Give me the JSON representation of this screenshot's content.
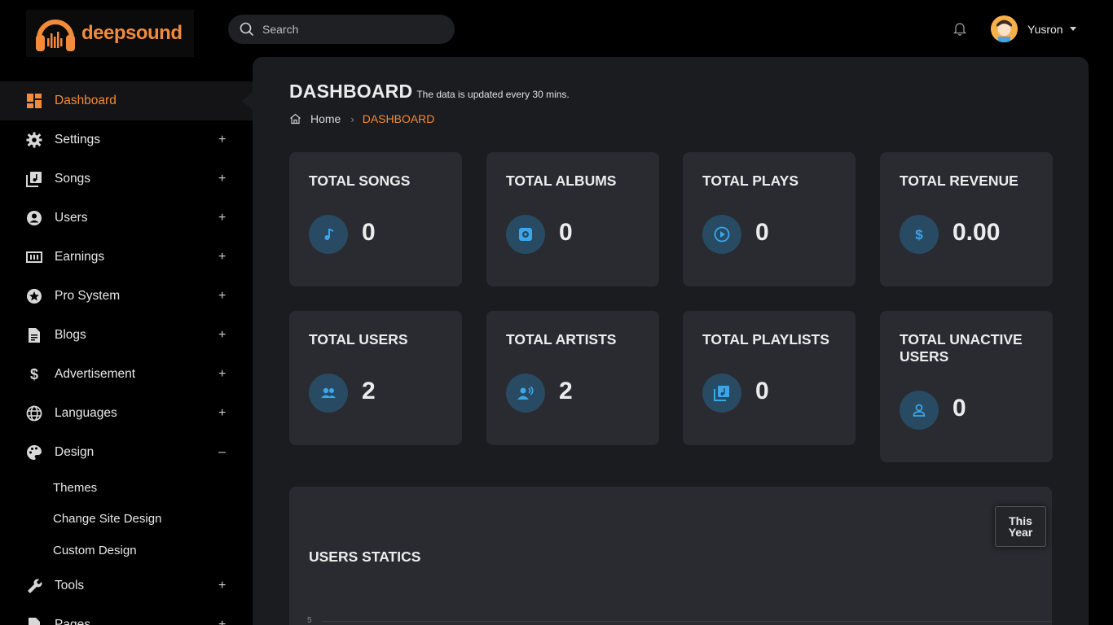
{
  "brand": {
    "name": "deepsound"
  },
  "search": {
    "placeholder": "Search"
  },
  "user": {
    "name": "Yusron"
  },
  "sidebar": {
    "items": [
      {
        "label": "Dashboard",
        "icon": "dashboard-icon",
        "toggle": ""
      },
      {
        "label": "Settings",
        "icon": "gear-icon",
        "toggle": "+"
      },
      {
        "label": "Songs",
        "icon": "music-library-icon",
        "toggle": "+"
      },
      {
        "label": "Users",
        "icon": "user-circle-icon",
        "toggle": "+"
      },
      {
        "label": "Earnings",
        "icon": "money-icon",
        "toggle": "+"
      },
      {
        "label": "Pro System",
        "icon": "star-icon",
        "toggle": "+"
      },
      {
        "label": "Blogs",
        "icon": "document-icon",
        "toggle": "+"
      },
      {
        "label": "Advertisement",
        "icon": "dollar-icon",
        "toggle": "+"
      },
      {
        "label": "Languages",
        "icon": "globe-icon",
        "toggle": "+"
      },
      {
        "label": "Design",
        "icon": "palette-icon",
        "toggle": "–"
      },
      {
        "label": "Tools",
        "icon": "wrench-icon",
        "toggle": "+"
      },
      {
        "label": "Pages",
        "icon": "page-icon",
        "toggle": "+"
      }
    ],
    "design_subitems": [
      "Themes",
      "Change Site Design",
      "Custom Design"
    ]
  },
  "page": {
    "title": "DASHBOARD",
    "subtitle": "The data is updated every 30 mins.",
    "breadcrumb": {
      "home": "Home",
      "current": "DASHBOARD"
    }
  },
  "cards": [
    {
      "title": "TOTAL SONGS",
      "value": "0",
      "icon": "music-note-icon"
    },
    {
      "title": "TOTAL ALBUMS",
      "value": "0",
      "icon": "disc-icon"
    },
    {
      "title": "TOTAL PLAYS",
      "value": "0",
      "icon": "play-circle-icon"
    },
    {
      "title": "TOTAL REVENUE",
      "value": "0.00",
      "icon": "dollar-icon"
    },
    {
      "title": "TOTAL USERS",
      "value": "2",
      "icon": "users-group-icon"
    },
    {
      "title": "TOTAL ARTISTS",
      "value": "2",
      "icon": "artist-icon"
    },
    {
      "title": "TOTAL PLAYLISTS",
      "value": "0",
      "icon": "playlist-icon"
    },
    {
      "title": "TOTAL UNACTIVE USERS",
      "value": "0",
      "icon": "user-outline-icon"
    }
  ],
  "stats": {
    "title": "USERS STATICS",
    "range_label": "This Year",
    "axis_tick": "5"
  },
  "colors": {
    "accent": "#f28b3a",
    "icon_blue": "#3ba7ea",
    "icon_bg": "#284a63",
    "panel": "#1b1c20",
    "card": "#2a2b30"
  }
}
